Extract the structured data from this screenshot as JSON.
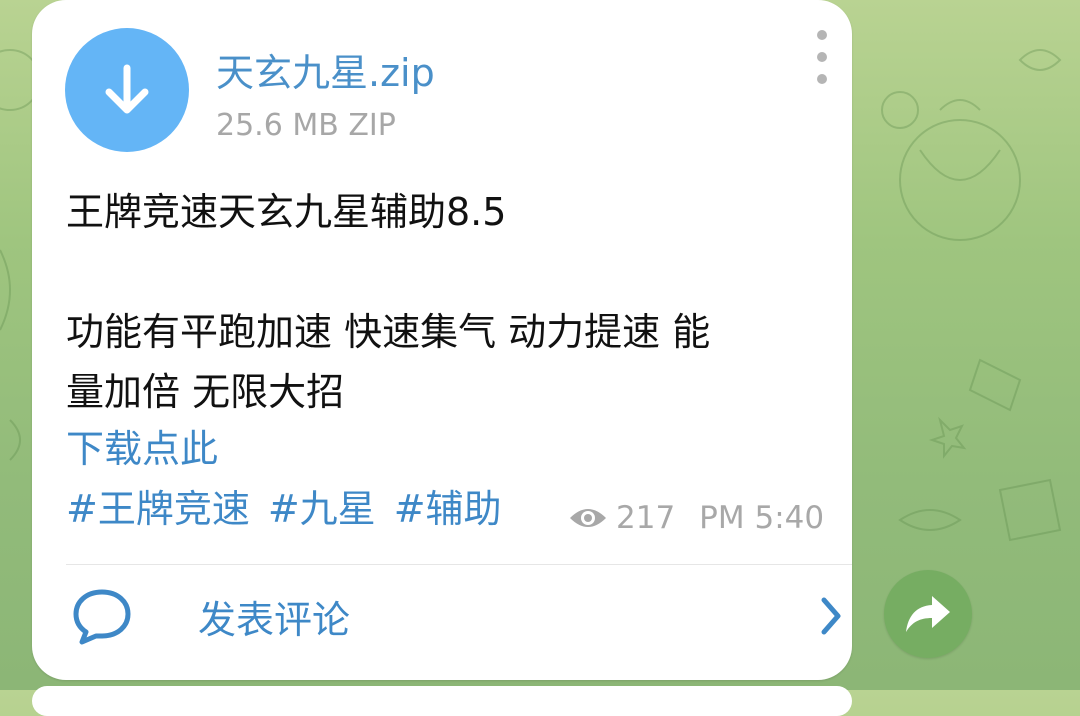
{
  "file": {
    "name": "天玄九星.zip",
    "meta": "25.6 MB ZIP"
  },
  "message": {
    "line1": "王牌竞速天玄九星辅助8.5",
    "line2": "功能有平跑加速 快速集气 动力提速 能",
    "line3": "量加倍 无限大招",
    "link": "下载点此",
    "hashtags": [
      "#王牌竞速",
      "#九星",
      "#辅助"
    ]
  },
  "stats": {
    "views": "217",
    "time": "PM 5:40"
  },
  "comment": {
    "label": "发表评论"
  },
  "colors": {
    "accent": "#3e88c7",
    "file_icon": "#64b5f6",
    "share_button": "#76ad62"
  },
  "icons": {
    "download": "download-icon",
    "more": "more-vertical-icon",
    "eye": "eye-icon",
    "comment": "comment-bubble-icon",
    "chevron": "chevron-right-icon",
    "share": "share-forward-icon"
  }
}
